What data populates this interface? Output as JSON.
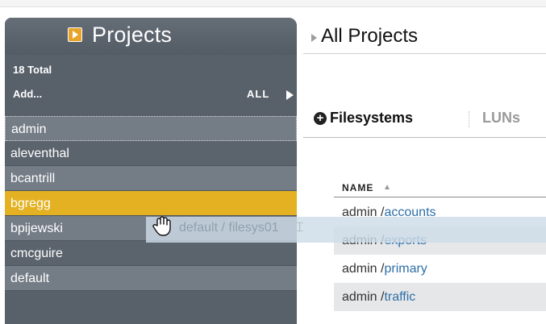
{
  "sidebar": {
    "title": "Projects",
    "total": "18 Total",
    "add_label": "Add...",
    "all_label": "ALL",
    "items": [
      {
        "label": "admin"
      },
      {
        "label": "aleventhal"
      },
      {
        "label": "bcantrill"
      },
      {
        "label": "bgregg"
      },
      {
        "label": "bpijewski"
      },
      {
        "label": "cmcguire"
      },
      {
        "label": "default"
      }
    ],
    "selected": "bgregg"
  },
  "main": {
    "breadcrumb": "All Projects",
    "tabs": [
      {
        "label": "Filesystems",
        "active": true
      },
      {
        "label": "LUNs",
        "active": false
      }
    ],
    "table": {
      "column_name": "NAME",
      "rows": [
        {
          "project": "admin /",
          "name": "accounts"
        },
        {
          "project": "admin /",
          "name": "exports"
        },
        {
          "project": "admin /",
          "name": "primary"
        },
        {
          "project": "admin /",
          "name": "traffic"
        }
      ]
    },
    "drag_ghost": "default / filesys01"
  },
  "colors": {
    "sidebar_bg": "#58606a",
    "selected_row": "#e3b121",
    "link": "#2e6fa8",
    "title_icon": "#e8a32a"
  }
}
